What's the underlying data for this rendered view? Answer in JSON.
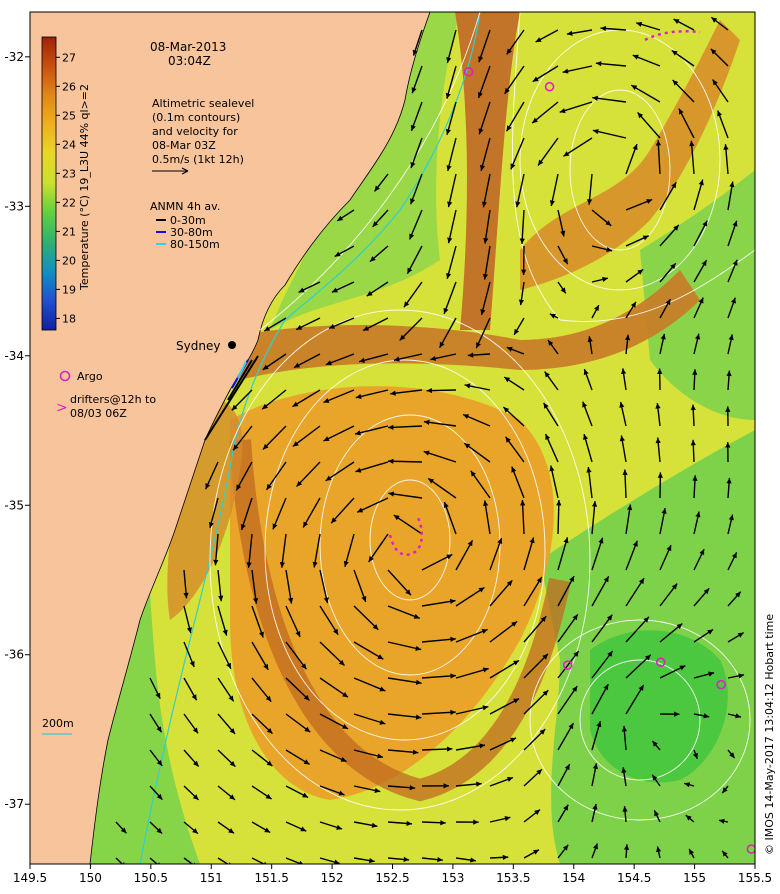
{
  "title": {
    "date": "08-Mar-2013",
    "time": "03:04Z"
  },
  "altimetry_note": {
    "lines": [
      "Altimetric sealevel",
      "(0.1m contours)",
      "and velocity for",
      "08-Mar 03Z",
      "0.5m/s (1kt 12h)"
    ]
  },
  "anmn": {
    "title": "ANMN 4h av.",
    "items": [
      {
        "label": "0-30m",
        "color": "#000000"
      },
      {
        "label": "30-80m",
        "color": "#1010e0"
      },
      {
        "label": "80-150m",
        "color": "#30d0f0"
      }
    ]
  },
  "markers": {
    "argo_label": "Argo",
    "drifters_symbol": ">",
    "drifters_lines": [
      "drifters@12h to",
      "08/03 06Z"
    ],
    "place": "Sydney",
    "depth_label": "200m"
  },
  "colorbar": {
    "label": "Temperature (°C) 19_L3U 44% ql>=2",
    "ticks": [
      "27",
      "26",
      "25",
      "24",
      "23",
      "22",
      "21",
      "20",
      "19",
      "18"
    ],
    "colors": [
      "#a02008",
      "#c85010",
      "#e08818",
      "#f0b020",
      "#e8d828",
      "#c8e030",
      "#60d040",
      "#30b070",
      "#1090c0",
      "#2050d0",
      "#1020a0"
    ]
  },
  "axes": {
    "x_ticks": [
      "149.5",
      "150",
      "150.5",
      "151",
      "151.5",
      "152",
      "152.5",
      "153",
      "153.5",
      "154",
      "154.5",
      "155",
      "155.5"
    ],
    "y_ticks": [
      "-32",
      "-33",
      "-34",
      "-35",
      "-36",
      "-37"
    ],
    "xlim": [
      149.5,
      155.5
    ],
    "ylim": [
      -37.4,
      -31.7
    ]
  },
  "credit": "© IMOS 14-May-2017 13:04:12 Hobart time",
  "colors": {
    "land": "#f7c49c",
    "warm_core": "#c87a28",
    "shelf_green": "#7ed24a",
    "contour": "#ffffff",
    "argo": "#e020c0"
  },
  "argo_floats": [
    {
      "lon": 153.13,
      "lat": -32.1
    },
    {
      "lon": 153.8,
      "lat": -32.2
    },
    {
      "lon": 153.95,
      "lat": -36.07
    },
    {
      "lon": 154.72,
      "lat": -36.05
    },
    {
      "lon": 155.22,
      "lat": -36.2
    },
    {
      "lon": 155.47,
      "lat": -37.3
    }
  ]
}
